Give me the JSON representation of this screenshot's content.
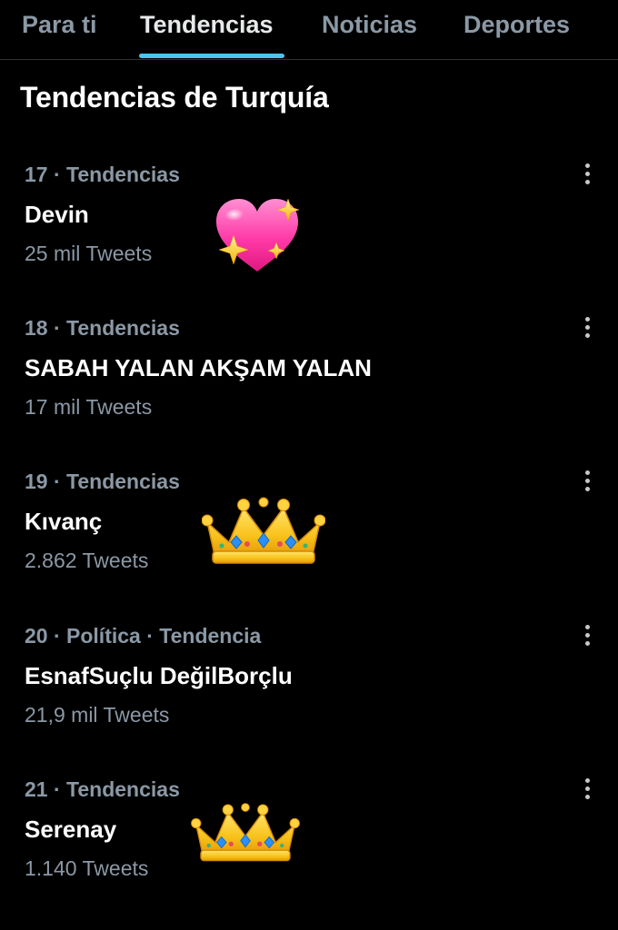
{
  "tabs": [
    {
      "label": "Para ti",
      "active": false
    },
    {
      "label": "Tendencias",
      "active": true
    },
    {
      "label": "Noticias",
      "active": false
    },
    {
      "label": "Deportes",
      "active": false
    }
  ],
  "section_title": "Tendencias de Turquía",
  "trends": [
    {
      "meta": "17 · Tendencias",
      "name": "Devin",
      "count": "25 mil Tweets",
      "emoji": "sparkling-heart-icon"
    },
    {
      "meta": "18 · Tendencias",
      "name": "SABAH YALAN AKŞAM YALAN",
      "count": "17 mil Tweets",
      "emoji": ""
    },
    {
      "meta": "19 · Tendencias",
      "name": "Kıvanç",
      "count": "2.862 Tweets",
      "emoji": "crown-icon"
    },
    {
      "meta": "20 · Política · Tendencia",
      "name": "EsnafSuçlu DeğilBorçlu",
      "count": "21,9 mil Tweets",
      "emoji": ""
    },
    {
      "meta": "21 · Tendencias",
      "name": "Serenay",
      "count": "1.140 Tweets",
      "emoji": "crown-icon"
    }
  ],
  "colors": {
    "background": "#000000",
    "primary_text": "#ffffff",
    "secondary_text": "#8b98a5",
    "accent": "#4cc3f0",
    "divider": "#2f3336"
  }
}
